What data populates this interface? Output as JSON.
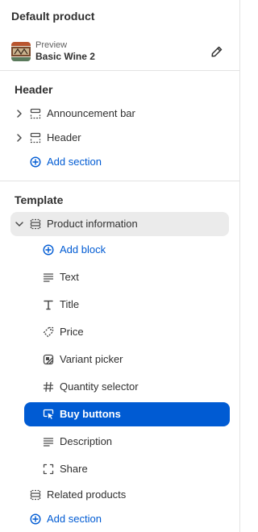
{
  "header": {
    "title": "Default product"
  },
  "preview": {
    "sub_label": "Preview",
    "product_name": "Basic Wine 2"
  },
  "header_group": {
    "title": "Header",
    "sections": [
      {
        "label": "Announcement bar"
      },
      {
        "label": "Header"
      }
    ],
    "add_label": "Add section"
  },
  "template_group": {
    "title": "Template",
    "product_information": {
      "label": "Product information",
      "add_block_label": "Add block",
      "blocks": [
        {
          "label": "Text",
          "icon": "text-icon"
        },
        {
          "label": "Title",
          "icon": "title-icon"
        },
        {
          "label": "Price",
          "icon": "price-tag-icon"
        },
        {
          "label": "Variant picker",
          "icon": "variant-picker-icon"
        },
        {
          "label": "Quantity selector",
          "icon": "hash-icon"
        },
        {
          "label": "Buy buttons",
          "icon": "cursor-click-icon",
          "selected": true
        },
        {
          "label": "Description",
          "icon": "text-icon"
        },
        {
          "label": "Share",
          "icon": "share-frame-icon"
        }
      ]
    },
    "related_products": {
      "label": "Related products"
    },
    "add_label": "Add section"
  },
  "colors": {
    "accent": "#005bd3",
    "selected_bg": "#005bd3",
    "active_bg": "#ebebeb",
    "text": "#303030"
  }
}
